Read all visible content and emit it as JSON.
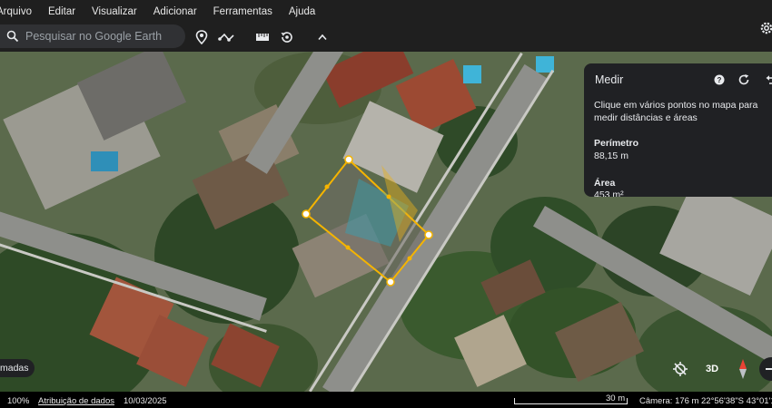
{
  "menu": {
    "items": [
      "Arquivo",
      "Editar",
      "Visualizar",
      "Adicionar",
      "Ferramentas",
      "Ajuda"
    ]
  },
  "toolbar": {
    "search_placeholder": "Pesquisar no Google Earth",
    "icons": [
      "search-icon",
      "placemark-icon",
      "path-icon",
      "ruler-icon",
      "historical-imagery-icon",
      "chevron-up-icon",
      "settings-icon"
    ]
  },
  "measure": {
    "title": "Medir",
    "help": "Clique em vários pontos no mapa para medir distâncias e áreas",
    "perimeter_label": "Perímetro",
    "perimeter_value": "88,15 m",
    "area_label": "Área",
    "area_value": "453 m²",
    "icons": [
      "help-icon",
      "refresh-icon",
      "undo-icon"
    ]
  },
  "map_controls": {
    "layers_label": "madas",
    "view_3d_label": "3D",
    "icons": [
      "layers-off-icon",
      "compass-icon",
      "zoom-out-icon"
    ]
  },
  "status": {
    "zoom": "100%",
    "attribution": "Atribuição de dados",
    "date": "10/03/2025",
    "scale": "30 m",
    "camera": "Câmera: 176 m",
    "coordinates": "22°56'38\"S 43°01'1"
  },
  "colors": {
    "chrome": "#1f1f1f",
    "panel": "#202124",
    "measure_outline": "#f5b400"
  }
}
